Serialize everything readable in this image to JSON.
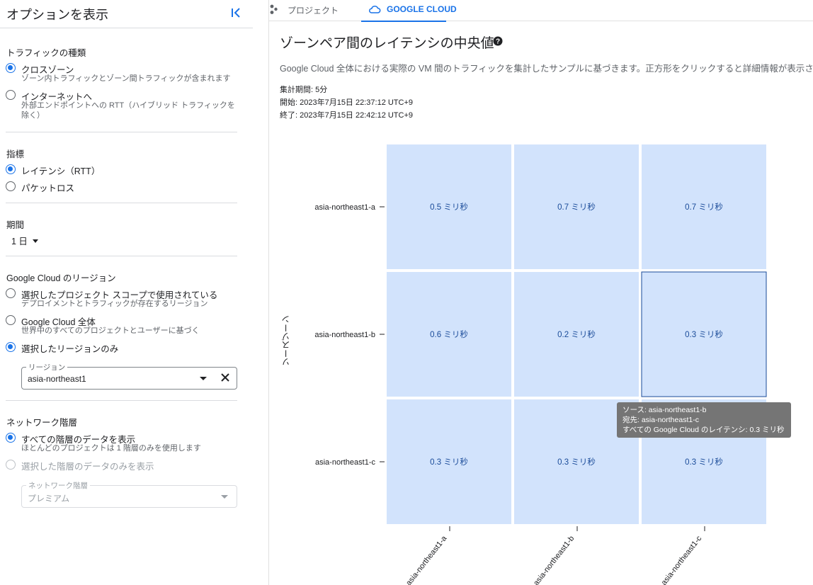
{
  "sidebar": {
    "title": "オプションを表示",
    "traffic": {
      "title": "トラフィックの種類",
      "options": [
        {
          "label": "クロスゾーン",
          "desc": "ゾーン内トラフィックとゾーン間トラフィックが含まれます"
        },
        {
          "label": "インターネットへ",
          "desc": "外部エンドポイントへの RTT（ハイブリッド トラフィックを除く）"
        }
      ]
    },
    "metric": {
      "title": "指標",
      "options": [
        {
          "label": "レイテンシ（RTT）"
        },
        {
          "label": "パケットロス"
        }
      ]
    },
    "period": {
      "title": "期間",
      "value": "1 日"
    },
    "region": {
      "title": "Google Cloud のリージョン",
      "options": [
        {
          "label": "選択したプロジェクト スコープで使用されている",
          "desc": "デプロイメントとトラフィックが存在するリージョン"
        },
        {
          "label": "Google Cloud 全体",
          "desc": "世界中のすべてのプロジェクトとユーザーに基づく"
        },
        {
          "label": "選択したリージョンのみ"
        }
      ],
      "field_label": "リージョン",
      "field_value": "asia-northeast1"
    },
    "network": {
      "title": "ネットワーク階層",
      "options": [
        {
          "label": "すべての階層のデータを表示",
          "desc": "ほとんどのプロジェクトは 1 階層のみを使用します"
        },
        {
          "label": "選択した階層のデータのみを表示"
        }
      ],
      "field_label": "ネットワーク階層",
      "field_value": "プレミアム"
    }
  },
  "tabs": [
    {
      "label": "プロジェクト",
      "icon": "project-icon"
    },
    {
      "label": "GOOGLE CLOUD",
      "icon": "cloud-icon"
    }
  ],
  "main": {
    "title": "ゾーンペア間のレイテンシの中央値",
    "description": "Google Cloud 全体における実際の VM 間のトラフィックを集計したサンプルに基づきます。正方形をクリックすると詳細情報が表示さ",
    "agg": "集計期間: 5分",
    "start": "開始: 2023年7月15日 22:37:12 UTC+9",
    "end": "終了: 2023年7月15日 22:42:12 UTC+9"
  },
  "chart_data": {
    "type": "heatmap",
    "ylabel": "ソースゾーン",
    "x": [
      "asia-northeast1-a",
      "asia-northeast1-b",
      "asia-northeast1-c"
    ],
    "y": [
      "asia-northeast1-a",
      "asia-northeast1-b",
      "asia-northeast1-c"
    ],
    "values": [
      [
        0.5,
        0.7,
        0.7
      ],
      [
        0.6,
        0.2,
        0.3
      ],
      [
        0.3,
        0.3,
        0.3
      ]
    ],
    "cell_labels": [
      [
        "0.5 ミリ秒",
        "0.7 ミリ秒",
        "0.7 ミリ秒"
      ],
      [
        "0.6 ミリ秒",
        "0.2 ミリ秒",
        "0.3 ミリ秒"
      ],
      [
        "0.3 ミリ秒",
        "0.3 ミリ秒",
        "0.3 ミリ秒"
      ]
    ],
    "cell_color": "#d2e3fc",
    "label_color": "#1a4b99"
  },
  "tooltip": {
    "line1": "ソース: asia-northeast1-b",
    "line2": "宛先: asia-northeast1-c",
    "line3": "すべての Google Cloud のレイテンシ: 0.3 ミリ秒"
  }
}
